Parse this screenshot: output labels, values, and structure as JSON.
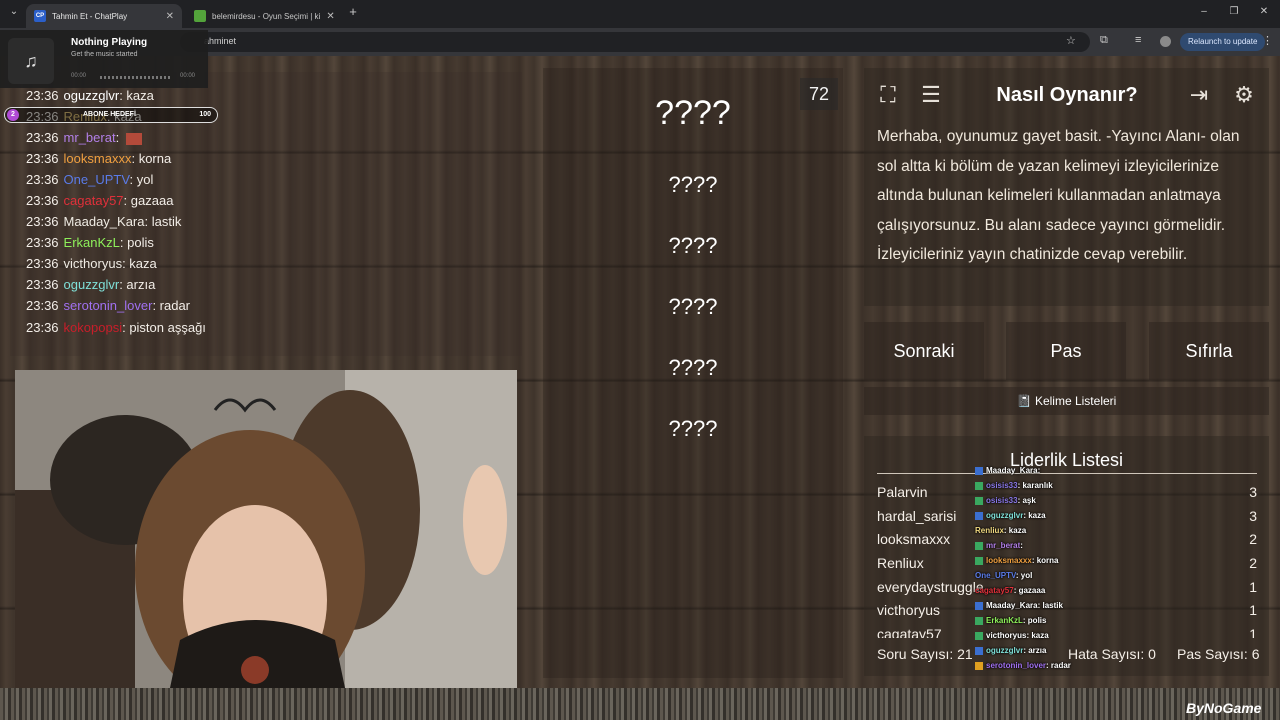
{
  "browser": {
    "tabs": [
      {
        "favicon": "CP",
        "title": "Tahmin Et - ChatPlay",
        "active": true
      },
      {
        "favicon": "",
        "title": "belemirdesu - Oyun Seçimi | ki",
        "active": false
      }
    ],
    "address_fragment": "ahminet",
    "relaunch_label": "Relaunch to update"
  },
  "music": {
    "title": "Nothing Playing",
    "subtitle": "Get the music started",
    "start_time": "00:00",
    "end_time": "00:00"
  },
  "sub_goal": {
    "badge": "2",
    "label": "ABONE HEDEFİ",
    "count": "100"
  },
  "chat": {
    "messages": [
      {
        "time": "23:36",
        "user": "oguzzglvr",
        "text": ": kaza",
        "color": "#ffffff"
      },
      {
        "time": "23:36",
        "user": "Renliux",
        "text": ": kaza",
        "color": "#e8c878"
      },
      {
        "time": "23:36",
        "user": "mr_berat",
        "text": ": ",
        "color": "#b27fe8"
      },
      {
        "time": "23:36",
        "user": "looksmaxxx",
        "text": ": korna",
        "color": "#f0a040"
      },
      {
        "time": "23:36",
        "user": "One_UPTV",
        "text": ": yol",
        "color": "#5a7be8"
      },
      {
        "time": "23:36",
        "user": "cagatay57",
        "text": ": gazaaa",
        "color": "#e0303a"
      },
      {
        "time": "23:36",
        "user": "Maaday_Kara",
        "text": ": lastik",
        "color": "#f0ece4"
      },
      {
        "time": "23:36",
        "user": "ErkanKzL",
        "text": ": polis",
        "color": "#8ef05a"
      },
      {
        "time": "23:36",
        "user": "victhoryus",
        "text": ": kaza",
        "color": "#f0ece4"
      },
      {
        "time": "23:36",
        "user": "oguzzglvr",
        "text": ": arzıa",
        "color": "#7fe0d8"
      },
      {
        "time": "23:36",
        "user": "serotonin_lover",
        "text": ": radar",
        "color": "#a070f0"
      },
      {
        "time": "23:36",
        "user": "kokopopsi",
        "text": ": piston aşşağı",
        "color": "#c81e2a"
      }
    ]
  },
  "game": {
    "timer": "72",
    "hidden_words": [
      "????",
      "????",
      "????",
      "????",
      "????",
      "????"
    ],
    "howto_title": "Nasıl Oynanır?",
    "howto_text": "Merhaba, oyunumuz gayet basit. -Yayıncı Alanı- olan sol altta ki bölüm de yazan kelimeyi izleyicilerinize altında bulunan kelimeleri kullanmadan anlatmaya çalışıyorsunuz. Bu alanı sadece yayıncı görmelidir. İzleyicileriniz yayın chatinizde cevap verebilir.",
    "buttons": {
      "next": "Sonraki",
      "pass": "Pas",
      "reset": "Sıfırla"
    },
    "word_lists": "Kelime Listeleri",
    "icons": [
      "fullscreen-icon",
      "list-icon",
      "exit-icon",
      "gear-icon"
    ]
  },
  "leaderboard": {
    "title": "Liderlik Listesi",
    "rows": [
      {
        "name": "Palarvin",
        "score": "3"
      },
      {
        "name": "hardal_sarisi",
        "score": "3"
      },
      {
        "name": "looksmaxxx",
        "score": "2"
      },
      {
        "name": "Renliux",
        "score": "2"
      },
      {
        "name": "everydaystruggle",
        "score": "1"
      },
      {
        "name": "victhoryus",
        "score": "1"
      },
      {
        "name": "cagatay57",
        "score": "1"
      }
    ],
    "question_count": "Soru Sayısı: 21",
    "error_count": "Hata Sayısı: 0",
    "pass_count": "Pas Sayısı: 6"
  },
  "overlay_chat": [
    {
      "user": "Maaday_Kara",
      "text": ":",
      "color": "#ffffff",
      "badge": "#3b6fd0"
    },
    {
      "user": "osisis33",
      "text": ": karanlık",
      "color": "#8a78e8",
      "badge": "#3aa860"
    },
    {
      "user": "osisis33",
      "text": ": aşk",
      "color": "#8a78e8",
      "badge": "#3aa860"
    },
    {
      "user": "oguzzglvr",
      "text": ": kaza",
      "color": "#7fe0d8",
      "badge": "#3b6fd0"
    },
    {
      "user": "Renliux",
      "text": ": kaza",
      "color": "#f0d880",
      "badge": ""
    },
    {
      "user": "mr_berat",
      "text": ":",
      "color": "#b27fe8",
      "badge": "#3aa860"
    },
    {
      "user": "looksmaxxx",
      "text": ": korna",
      "color": "#f0a040",
      "badge": "#3aa860"
    },
    {
      "user": "One_UPTV",
      "text": ": yol",
      "color": "#5a7be8",
      "badge": ""
    },
    {
      "user": "cagatay57",
      "text": ": gazaaa",
      "color": "#e0303a",
      "badge": ""
    },
    {
      "user": "Maaday_Kara",
      "text": ": lastik",
      "color": "#ffffff",
      "badge": "#3b6fd0"
    },
    {
      "user": "ErkanKzL",
      "text": ": polis",
      "color": "#8ef05a",
      "badge": "#3aa860"
    },
    {
      "user": "victhoryus",
      "text": ": kaza",
      "color": "#ffffff",
      "badge": "#3aa860"
    },
    {
      "user": "oguzzglvr",
      "text": ": arzıa",
      "color": "#7fe0d8",
      "badge": "#3b6fd0"
    },
    {
      "user": "serotonin_lover",
      "text": ": radar",
      "color": "#a070f0",
      "badge": "#e0a020"
    }
  ],
  "brand": "ByNoGame"
}
